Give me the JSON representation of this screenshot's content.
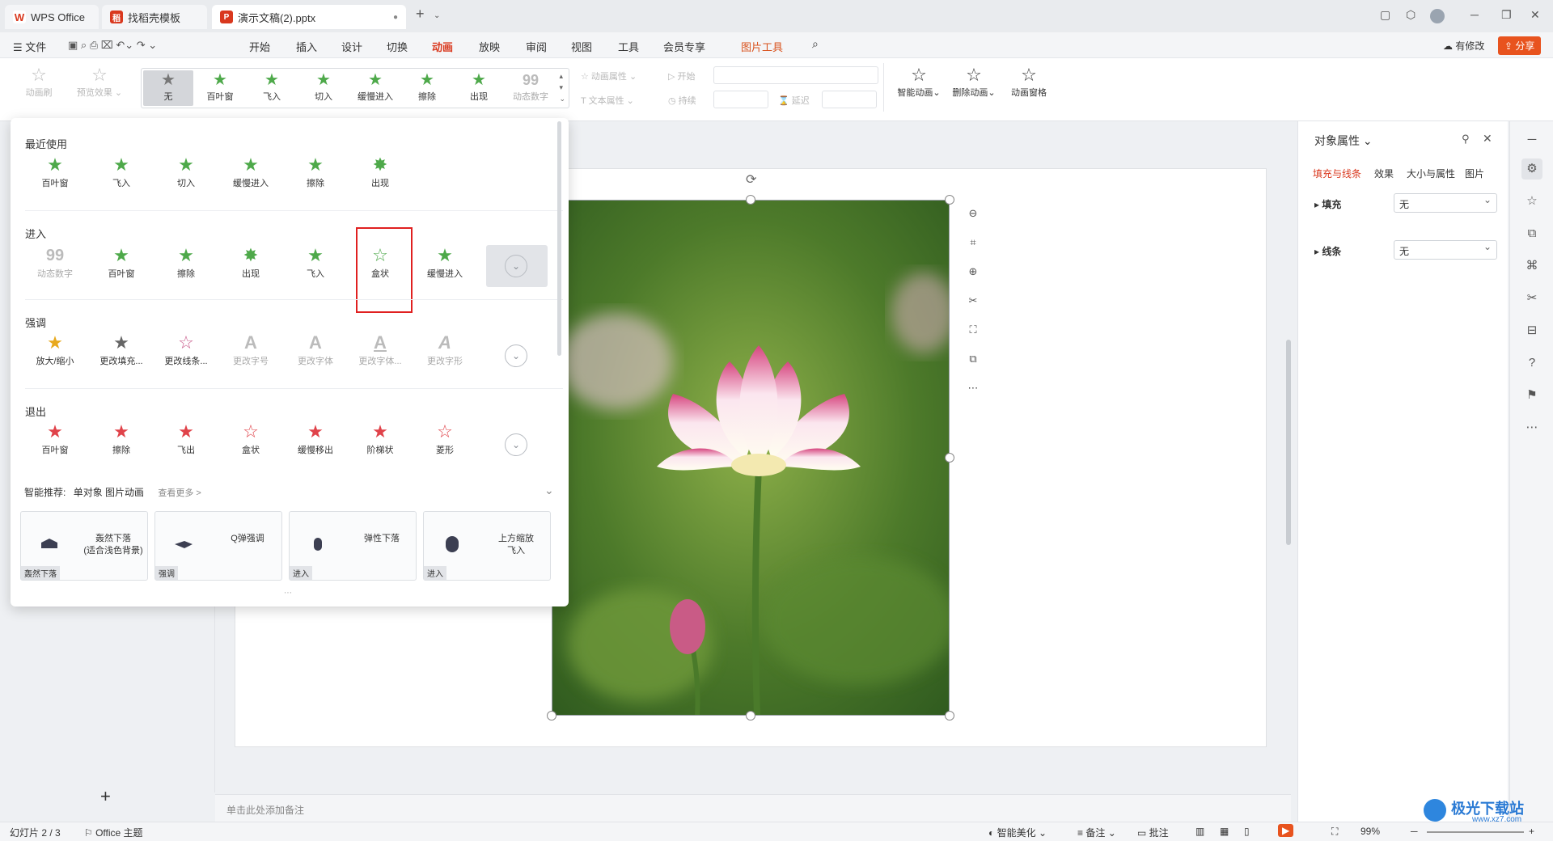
{
  "titlebar": {
    "tabs": [
      {
        "label": "WPS Office",
        "icon": "wps-logo-icon",
        "active": false
      },
      {
        "label": "找稻壳模板",
        "icon": "docer-icon",
        "active": false
      },
      {
        "label": "演示文稿(2).pptx",
        "icon": "ppt-icon",
        "active": true
      }
    ],
    "new_tab": "+"
  },
  "menubar": {
    "file_label": "文件",
    "items": [
      "开始",
      "插入",
      "设计",
      "切换",
      "动画",
      "放映",
      "审阅",
      "视图",
      "工具",
      "会员专享",
      "图片工具"
    ],
    "active": "动画",
    "modified_label": "有修改",
    "share_label": "分享"
  },
  "ribbon": {
    "animation_brush": "动画刷",
    "preview_effect": "预览效果",
    "gallery": [
      "无",
      "百叶窗",
      "飞入",
      "切入",
      "缓慢进入",
      "擦除",
      "出现",
      "动态数字"
    ],
    "anim_props": "动画属性",
    "text_props": "文本属性",
    "start_label": "开始",
    "duration_label": "持续",
    "delay_label": "延迟",
    "smart_anim": "智能动画",
    "delete_anim": "删除动画",
    "anim_pane": "动画窗格"
  },
  "dropdown": {
    "recent_title": "最近使用",
    "recent": [
      "百叶窗",
      "飞入",
      "切入",
      "缓慢进入",
      "擦除",
      "出现"
    ],
    "enter_title": "进入",
    "enter": [
      "动态数字",
      "百叶窗",
      "擦除",
      "出现",
      "飞入",
      "盒状",
      "缓慢进入"
    ],
    "emphasis_title": "强调",
    "emphasis": [
      "放大/缩小",
      "更改填充...",
      "更改线条...",
      "更改字号",
      "更改字体",
      "更改字体...",
      "更改字形"
    ],
    "exit_title": "退出",
    "exit": [
      "百叶窗",
      "擦除",
      "飞出",
      "盒状",
      "缓慢移出",
      "阶梯状",
      "菱形"
    ],
    "smart_label": "智能推荐:",
    "smart_sub": "单对象 图片动画",
    "see_more": "查看更多 >",
    "cards": [
      {
        "name": "轰然下落\n(适合浅色背景)",
        "tag": "轰然下落"
      },
      {
        "name": "Q弹强调",
        "tag": "强调"
      },
      {
        "name": "弹性下落",
        "tag": "进入"
      },
      {
        "name": "上方缩放\n飞入",
        "tag": "进入"
      }
    ],
    "highlight_color": "#e02020"
  },
  "props": {
    "title": "对象属性",
    "tabs": [
      "填充与线条",
      "效果",
      "大小与属性",
      "图片"
    ],
    "fill_label": "填充",
    "fill_value": "无",
    "line_label": "线条",
    "line_value": "无"
  },
  "notes_placeholder": "单击此处添加备注",
  "statusbar": {
    "slide": "幻灯片 2 / 3",
    "theme": "Office 主题",
    "beautify": "智能美化",
    "notes": "备注",
    "comments": "批注",
    "zoom": "99%"
  },
  "watermark": "极光下载站",
  "watermark_url": "www.xz7.com"
}
